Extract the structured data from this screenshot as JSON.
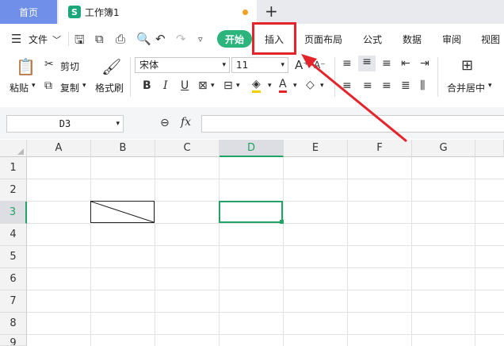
{
  "tabs": {
    "home": "首页",
    "doc_title": "工作簿1",
    "doc_icon": "S",
    "new_tab": "+"
  },
  "menu": {
    "file": "文件",
    "items": [
      "开始",
      "插入",
      "页面布局",
      "公式",
      "数据",
      "审阅",
      "视图"
    ]
  },
  "ribbon": {
    "paste": "粘贴",
    "cut": "剪切",
    "copy": "复制",
    "format_painter": "格式刷",
    "font_name": "宋体",
    "font_size": "11",
    "bold": "B",
    "italic": "I",
    "underline": "U",
    "font_color": "A",
    "grow_font": "A⁺",
    "shrink_font": "A⁻",
    "merge_center": "合并居中"
  },
  "formula_bar": {
    "cell_ref": "D3",
    "fx": "fx",
    "formula": ""
  },
  "grid": {
    "columns": [
      "A",
      "B",
      "C",
      "D",
      "E",
      "F",
      "G"
    ],
    "rows": [
      "1",
      "2",
      "3",
      "4",
      "5",
      "6",
      "7",
      "8",
      "9"
    ],
    "selected_cell": "D3",
    "selected_column": "D",
    "selected_row": "3"
  },
  "colors": {
    "accent_green": "#21a366",
    "highlight_red": "#e3242b",
    "home_tab_blue": "#6f8fe8"
  }
}
